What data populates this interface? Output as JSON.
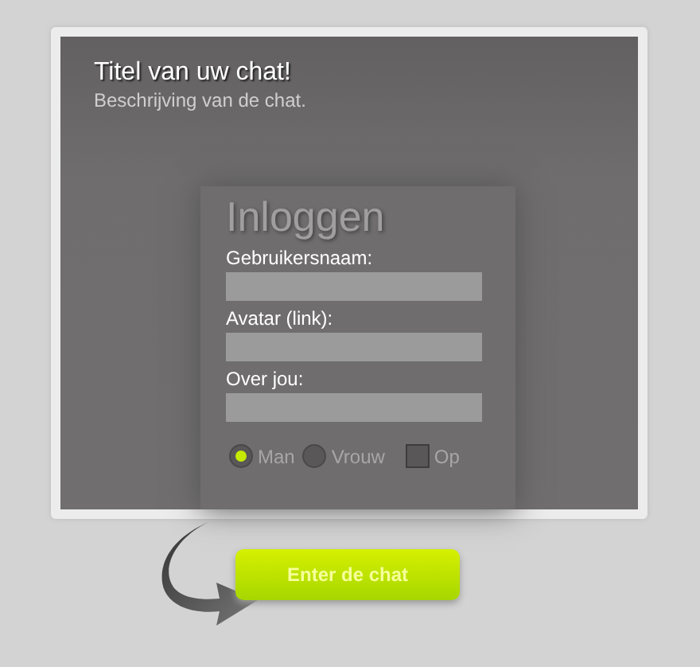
{
  "header": {
    "title": "Titel van uw chat!",
    "description": "Beschrijving van de chat."
  },
  "login": {
    "title": "Inloggen",
    "fields": [
      {
        "label": "Gebruikersnaam:"
      },
      {
        "label": "Avatar (link):"
      },
      {
        "label": "Over jou:"
      }
    ],
    "gender": [
      {
        "label": "Man",
        "selected": true
      },
      {
        "label": "Vrouw",
        "selected": false
      }
    ],
    "checkbox": {
      "label": "Op",
      "checked": false
    }
  },
  "button": "Enter de chat"
}
